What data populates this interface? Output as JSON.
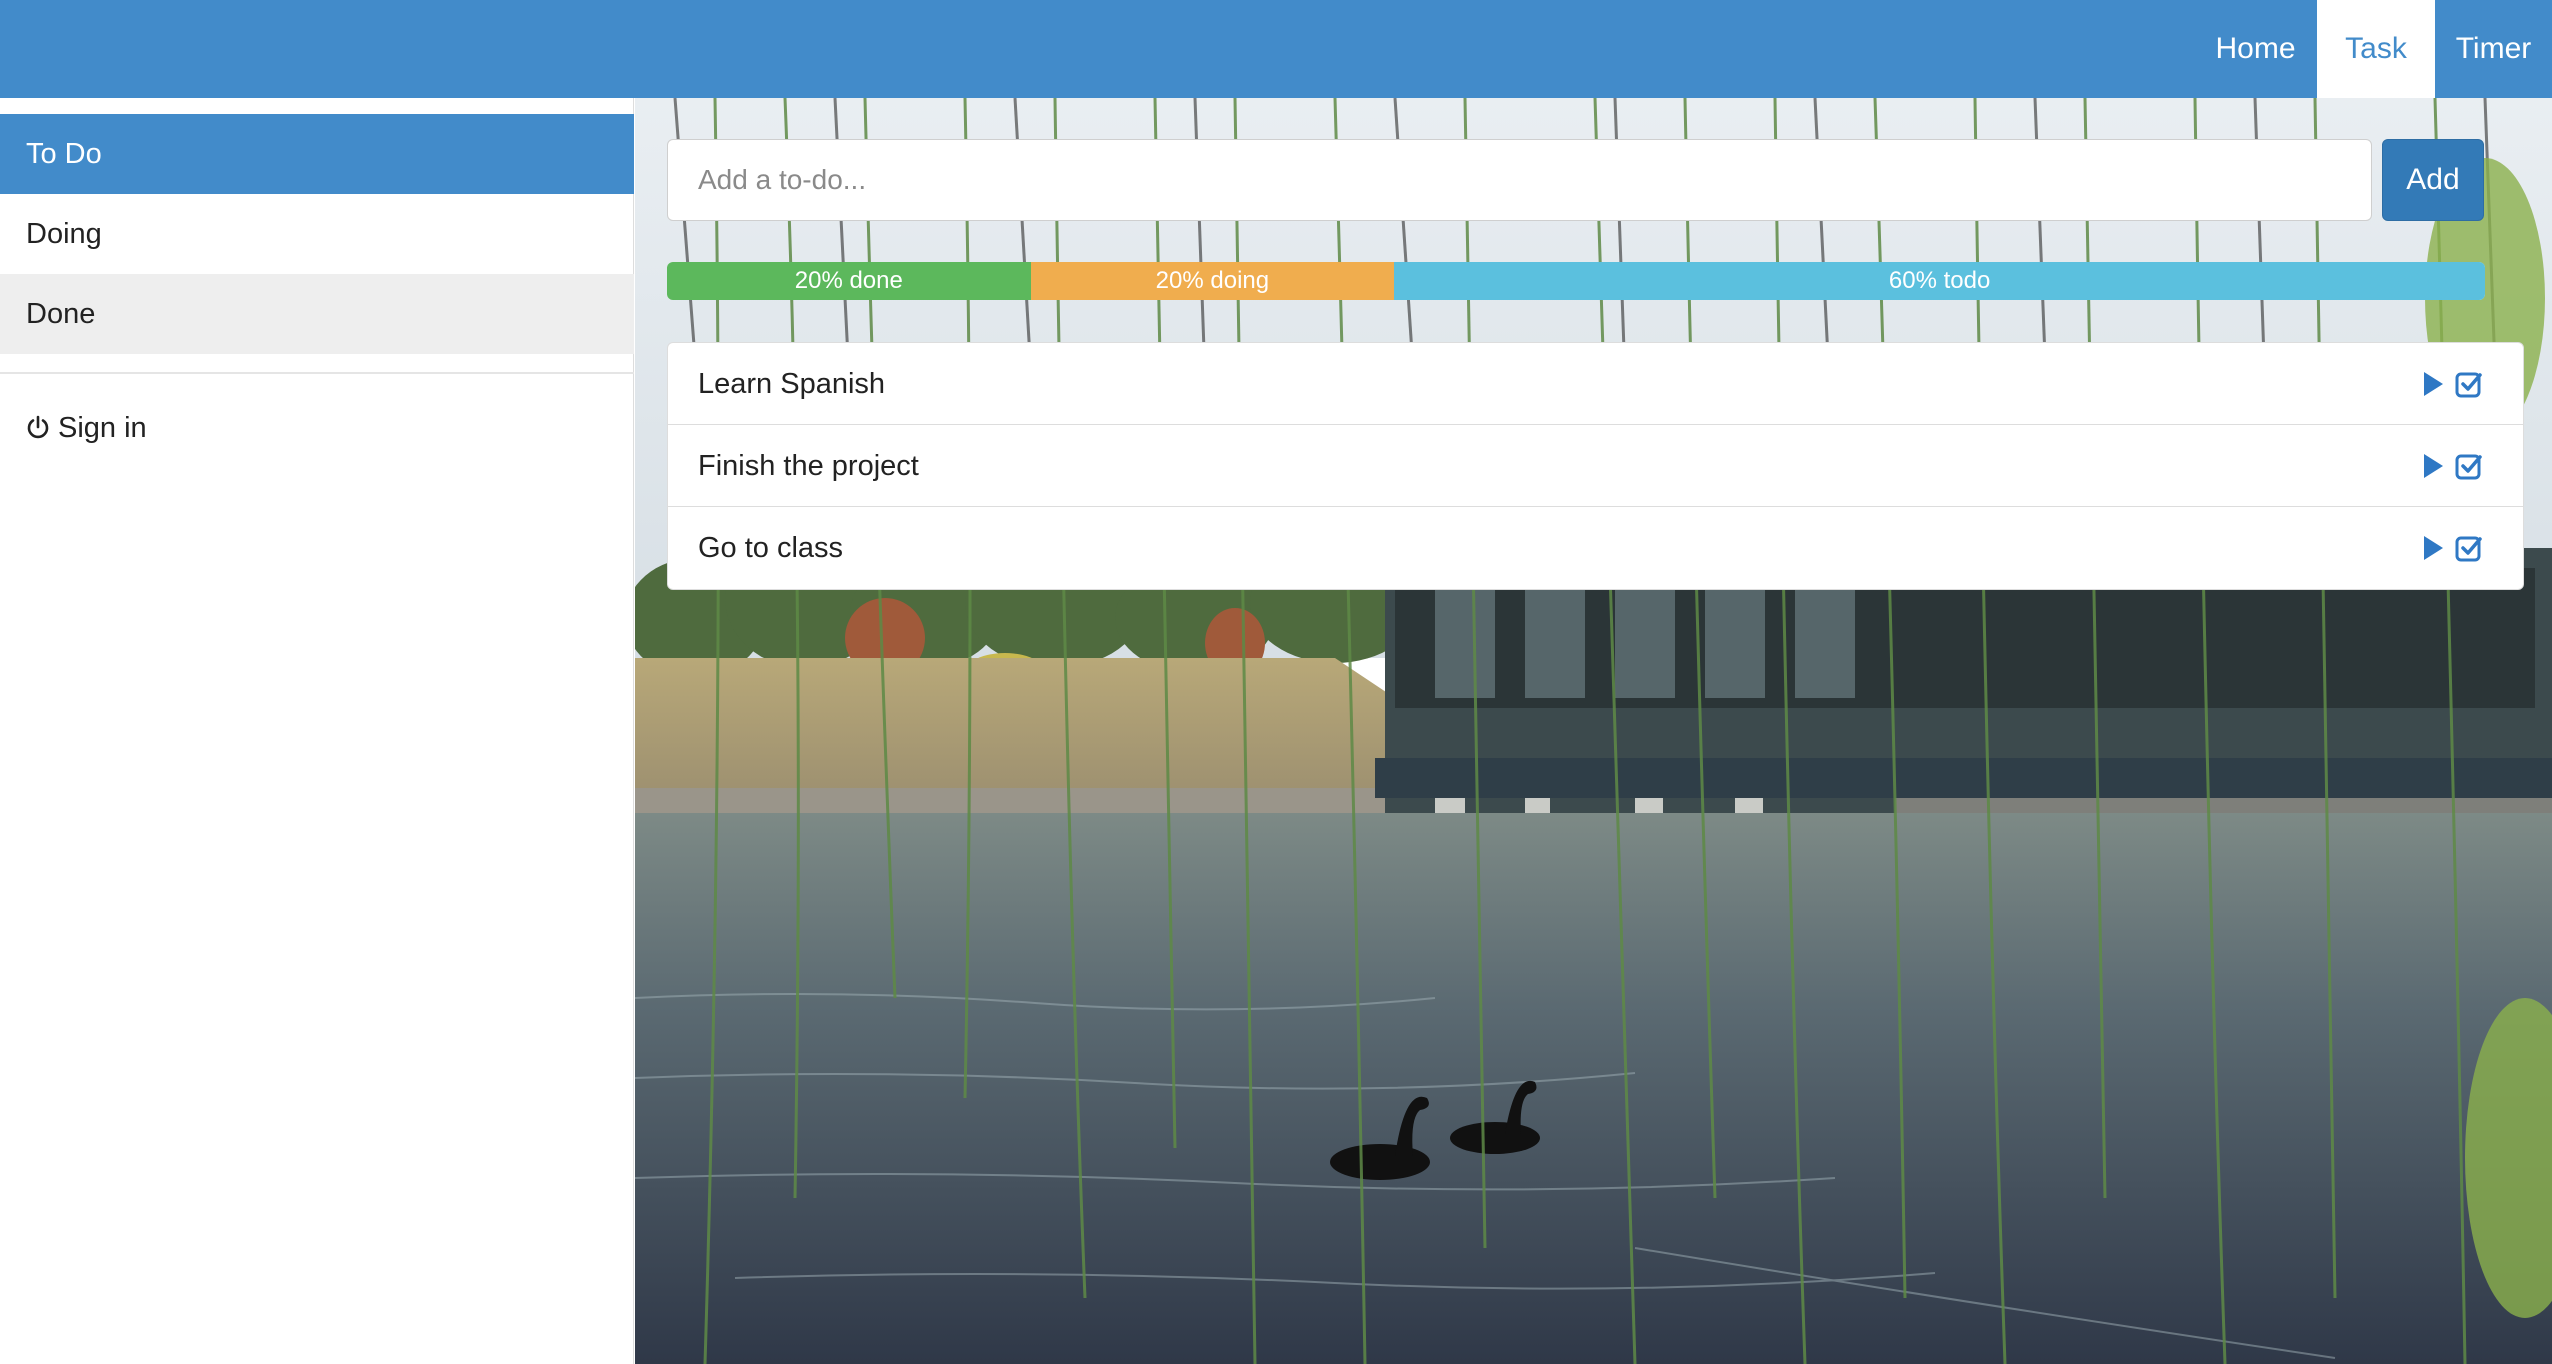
{
  "nav": {
    "home": "Home",
    "task": "Task",
    "timer": "Timer",
    "active": "Task"
  },
  "sidebar": {
    "items": [
      {
        "label": "To Do",
        "state": "active"
      },
      {
        "label": "Doing",
        "state": "normal"
      },
      {
        "label": "Done",
        "state": "hover"
      }
    ],
    "signin_label": "Sign in",
    "signin_icon": "power-icon"
  },
  "add_todo": {
    "placeholder": "Add a to-do...",
    "value": "",
    "button_label": "Add"
  },
  "progress": [
    {
      "label": "20% done",
      "percent": 20,
      "color": "#5cb85c"
    },
    {
      "label": "20% doing",
      "percent": 20,
      "color": "#f0ad4e"
    },
    {
      "label": "60% todo",
      "percent": 60,
      "color": "#5bc0de"
    }
  ],
  "tasks": [
    {
      "title": "Learn Spanish",
      "icons": [
        "play-icon",
        "check-square-icon"
      ]
    },
    {
      "title": "Finish the project",
      "icons": [
        "play-icon",
        "check-square-icon"
      ]
    },
    {
      "title": "Go to class",
      "icons": [
        "play-icon",
        "check-square-icon"
      ]
    }
  ],
  "colors": {
    "primary": "#428bca",
    "button": "#337ab7",
    "done": "#5cb85c",
    "doing": "#f0ad4e",
    "todo": "#5bc0de"
  }
}
